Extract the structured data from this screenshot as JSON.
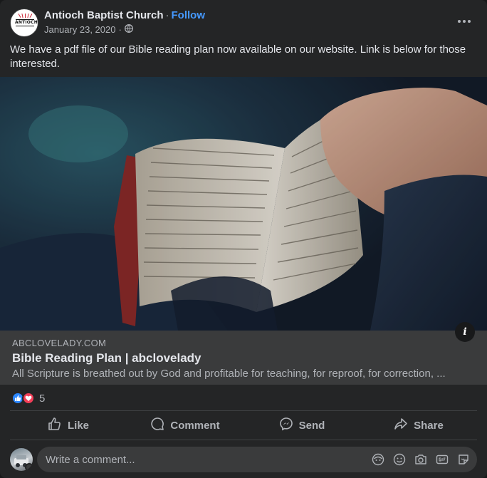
{
  "post": {
    "page_name": "Antioch Baptist Church",
    "separator": "·",
    "follow_label": "Follow",
    "date": "January 23, 2020",
    "date_separator": "·",
    "privacy_icon": "globe-icon",
    "avatar_logo_text": "ANTIOCH",
    "text": "We have a pdf file of our Bible reading plan now available on our website. Link is below for those interested."
  },
  "link_preview": {
    "domain": "ABCLOVELADY.COM",
    "title": "Bible Reading Plan | abclovelady",
    "description": "All Scripture is breathed out by God and profitable for teaching, for reproof, for correction, ...",
    "info_label": "i"
  },
  "reactions": {
    "icons": [
      "like-reaction-icon",
      "love-reaction-icon"
    ],
    "count": "5"
  },
  "actions": [
    {
      "label": "Like",
      "icon": "thumbs-up-icon"
    },
    {
      "label": "Comment",
      "icon": "comment-bubble-icon"
    },
    {
      "label": "Send",
      "icon": "messenger-icon"
    },
    {
      "label": "Share",
      "icon": "share-arrow-icon"
    }
  ],
  "comment": {
    "placeholder": "Write a comment...",
    "icons": [
      "avatar-sticker-icon",
      "emoji-icon",
      "camera-icon",
      "gif-icon",
      "sticker-icon"
    ]
  },
  "colors": {
    "card_bg": "#242526",
    "link_bg": "#3a3b3c",
    "follow": "#4599ff",
    "like_blue": "#2d88ff",
    "love_red": "#f33e58"
  }
}
